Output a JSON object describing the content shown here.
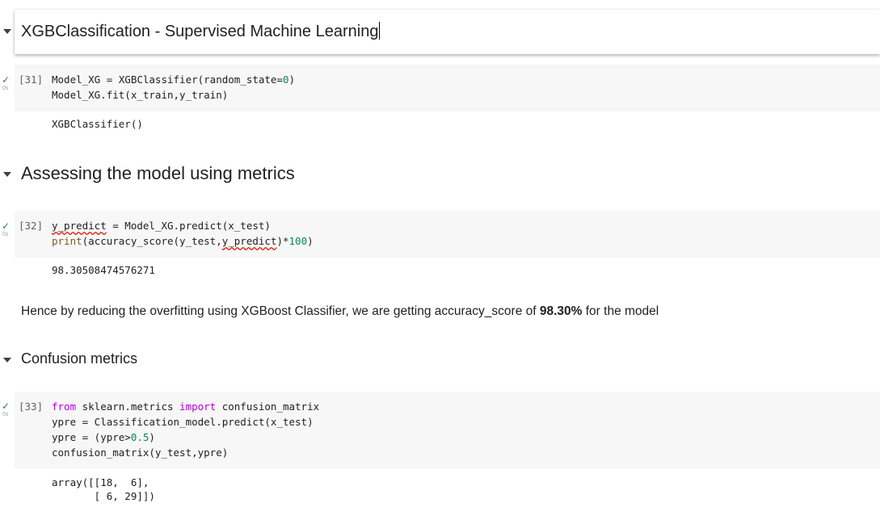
{
  "header1": {
    "title": "XGBClassification - Supervised Machine Learning"
  },
  "cell31": {
    "count": "[31]",
    "time": "0s",
    "lines": [
      {
        "a": "Model_XG = XGBClassifier(random_state=",
        "b": "0",
        "c": ")"
      },
      {
        "a": "Model_XG.fit(x_train,y_train)"
      }
    ],
    "output": "XGBClassifier()"
  },
  "header2": {
    "title": "Assessing the model using metrics"
  },
  "cell32": {
    "count": "[32]",
    "time": "0s",
    "line1": {
      "a": "y_predict",
      "b": " = Model_XG.predict(x_test)"
    },
    "line2": {
      "fn": "print",
      "a": "(accuracy_score(y_test,",
      "b": "y_predict",
      "c": ")*",
      "d": "100",
      "e": ")"
    },
    "output": "98.30508474576271"
  },
  "text_cell": {
    "prefix": "Hence by reducing the overfitting using XGBoost Classifier, we are getting accuracy_score of ",
    "bold": "98.30%",
    "suffix": " for the model"
  },
  "header3": {
    "title": "Confusion metrics"
  },
  "cell33": {
    "count": "[33]",
    "time": "0s",
    "line1": {
      "kw1": "from",
      "a": " sklearn.metrics ",
      "kw2": "import",
      "b": " confusion_matrix"
    },
    "line2": {
      "a": "ypre = Classification_model.predict(x_test)"
    },
    "line3": {
      "a": "ypre = (ypre>",
      "b": "0.5",
      "c": ")"
    },
    "line4": {
      "a": "confusion_matrix(y_test,ypre)"
    },
    "output1": "array([[18,  6],",
    "output2": "       [ 6, 29]])"
  },
  "icons": {
    "collapse": "chevron-down-icon",
    "run_status": "check-icon"
  },
  "colors": {
    "keyword": "#af00db",
    "number": "#098658",
    "function": "#795e26",
    "success": "#1e8e3e"
  }
}
